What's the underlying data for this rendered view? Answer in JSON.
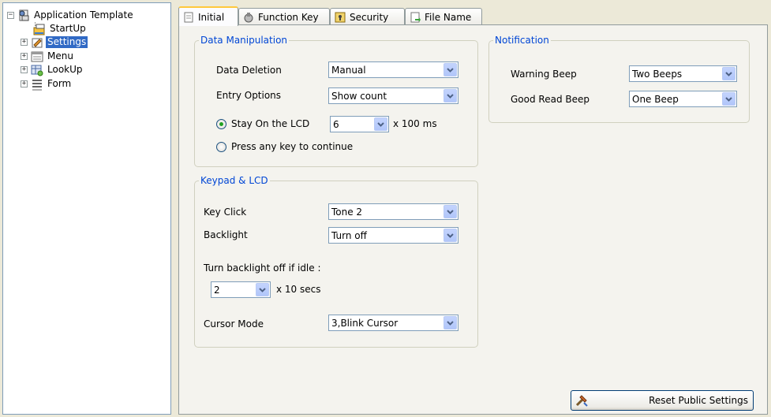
{
  "tree": {
    "root": "Application Template",
    "items": [
      {
        "label": "StartUp",
        "icon": "startup-icon"
      },
      {
        "label": "Settings",
        "icon": "settings-icon",
        "selected": true
      },
      {
        "label": "Menu",
        "icon": "menu-icon"
      },
      {
        "label": "LookUp",
        "icon": "lookup-icon"
      },
      {
        "label": "Form",
        "icon": "form-icon"
      }
    ]
  },
  "tabs": [
    {
      "label": "Initial",
      "icon": "document-icon",
      "active": true
    },
    {
      "label": "Function Key",
      "icon": "function-key-icon"
    },
    {
      "label": "Security",
      "icon": "security-icon"
    },
    {
      "label": "File Name",
      "icon": "file-icon"
    }
  ],
  "data_manipulation": {
    "title": "Data Manipulation",
    "data_deletion_label": "Data Deletion",
    "data_deletion_value": "Manual",
    "entry_options_label": "Entry Options",
    "entry_options_value": "Show count",
    "stay_label": "Stay On the LCD",
    "stay_value": "6",
    "stay_unit": "x 100 ms",
    "press_label": "Press any key to continue",
    "selected_option": "Stay On the LCD"
  },
  "keypad": {
    "title": "Keypad & LCD",
    "key_click_label": "Key Click",
    "key_click_value": "Tone 2",
    "backlight_label": "Backlight",
    "backlight_value": "Turn off",
    "idle_label": "Turn backlight off if idle :",
    "idle_value": "2",
    "idle_unit": "x 10 secs",
    "cursor_label": "Cursor Mode",
    "cursor_value": "3,Blink Cursor"
  },
  "notification": {
    "title": "Notification",
    "warning_label": "Warning Beep",
    "warning_value": "Two Beeps",
    "good_label": "Good Read Beep",
    "good_value": "One Beep"
  },
  "reset_button": "Reset Public Settings",
  "colors": {
    "accent": "#316AC5",
    "legend": "#0046D5",
    "radio_selected": "#21A121"
  }
}
